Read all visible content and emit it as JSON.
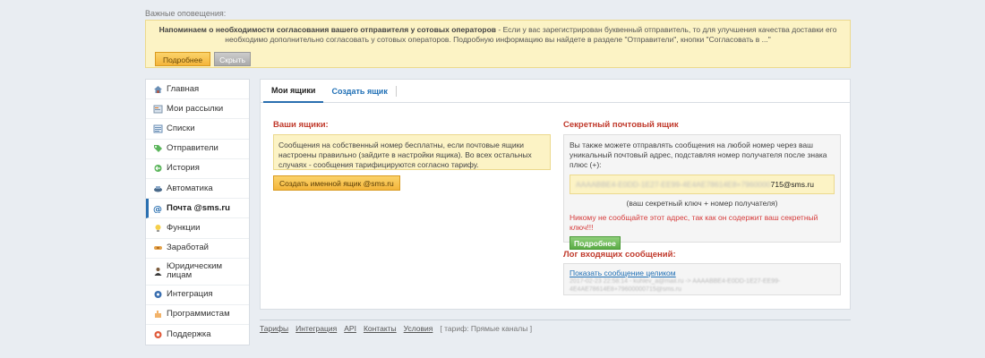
{
  "notice": {
    "heading": "Важные оповещения:",
    "bold": "Напоминаем о необходимости согласования вашего отправителя у сотовых операторов",
    "text": " - Если у вас зарегистрирован буквенный отправитель, то для улучшения качества доставки его необходимо дополнительно согласовать у сотовых операторов. Подробную информацию вы найдете в разделе \"Отправители\", кнопки \"Согласовать в ...\"",
    "more_label": "Подробнее",
    "hide_label": "Скрыть"
  },
  "sidebar": {
    "items": [
      {
        "label": "Главная",
        "icon": "home-icon"
      },
      {
        "label": "Мои рассылки",
        "icon": "mailing-icon"
      },
      {
        "label": "Списки",
        "icon": "list-icon"
      },
      {
        "label": "Отправители",
        "icon": "tag-icon"
      },
      {
        "label": "История",
        "icon": "history-icon"
      },
      {
        "label": "Автоматика",
        "icon": "automation-icon"
      },
      {
        "label": "Почта @sms.ru",
        "icon": "at-icon"
      },
      {
        "label": "Функции",
        "icon": "bulb-icon"
      },
      {
        "label": "Заработай",
        "icon": "handshake-icon"
      },
      {
        "label": "Юридическим лицам",
        "icon": "person-icon"
      },
      {
        "label": "Интеграция",
        "icon": "integration-icon"
      },
      {
        "label": "Программистам",
        "icon": "hand-icon"
      },
      {
        "label": "Поддержка",
        "icon": "lifebuoy-icon"
      }
    ]
  },
  "tabs": {
    "my_boxes": "Мои ящики",
    "create_box": "Создать ящик"
  },
  "left": {
    "title": "Ваши ящики:",
    "info": "Сообщения на собственный номер бесплатны, если почтовые ящики настроены правильно (зайдите в настройки ящика). Во всех остальных случаях - сообщения тарифицируются согласно тарифу.",
    "create_button": "Создать именной ящик @sms.ru"
  },
  "right": {
    "title": "Секретный почтовый ящик",
    "description": "Вы также можете отправлять сообщения на любой номер через ваш уникальный почтовый адрес, подставляя номер получателя после знака плюс (+):",
    "address_hidden": "AAAABBE4-E0DD-1E27-EE99-4E4AE78614E8+7960000",
    "address_visible": "715@sms.ru",
    "hint": "(ваш секретный ключ + номер получателя)",
    "warning": "Никому не сообщайте этот адрес, так как он содержит ваш секретный ключ!!!",
    "more_button": "Подробнее",
    "log_title": "Лог входящих сообщений:",
    "log_link": "Показать сообщение целиком",
    "log_line1": "2017-02-23 22:58:14 - kuhlev_a@mail.ru -> AAAABBE4-E0DD-1E27-EE99-",
    "log_line2": "4E4AE78614E8+79600000715@sms.ru"
  },
  "footer": {
    "links": [
      "Тарифы",
      "Интеграция",
      "API",
      "Контакты",
      "Условия"
    ],
    "tariff": "[ тариф: Прямые каналы ]"
  },
  "colors": {
    "accent": "#2a6fb0",
    "warning": "#d63b3b",
    "title_red": "#c0392b",
    "notice_bg": "#fcf3c5",
    "button_green": "#5aab45",
    "button_orange": "#f4b53a"
  }
}
